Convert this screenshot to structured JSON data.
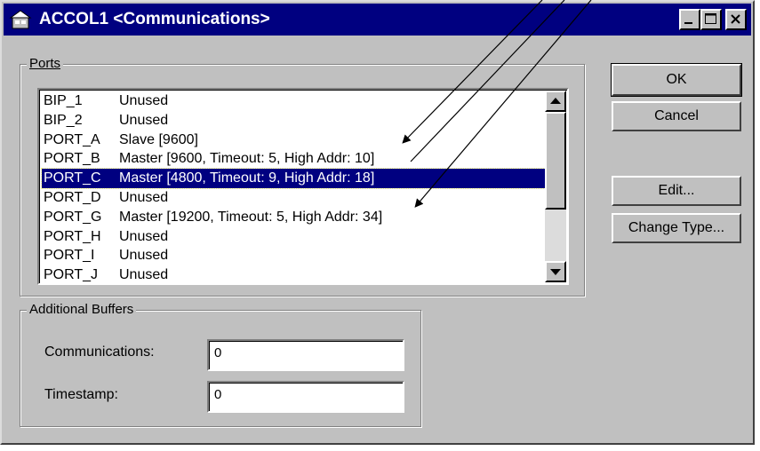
{
  "window": {
    "title": "ACCOL1 <Communications>"
  },
  "ports": {
    "group_label": "Ports",
    "items": [
      {
        "name": "BIP_1",
        "value": "Unused",
        "selected": false
      },
      {
        "name": "BIP_2",
        "value": "Unused",
        "selected": false
      },
      {
        "name": "PORT_A",
        "value": "Slave [9600]",
        "selected": false
      },
      {
        "name": "PORT_B",
        "value": "Master [9600, Timeout: 5, High Addr: 10]",
        "selected": false
      },
      {
        "name": "PORT_C",
        "value": "Master [4800, Timeout: 9, High Addr: 18]",
        "selected": true
      },
      {
        "name": "PORT_D",
        "value": "Unused",
        "selected": false
      },
      {
        "name": "PORT_G",
        "value": "Master [19200, Timeout: 5, High Addr: 34]",
        "selected": false
      },
      {
        "name": "PORT_H",
        "value": "Unused",
        "selected": false
      },
      {
        "name": "PORT_I",
        "value": "Unused",
        "selected": false
      },
      {
        "name": "PORT_J",
        "value": "Unused",
        "selected": false
      }
    ]
  },
  "buttons": {
    "ok": "OK",
    "cancel": "Cancel",
    "edit": "Edit...",
    "change_type": "Change Type..."
  },
  "buffers": {
    "group_label": "Additional Buffers",
    "communications_label": "Communications:",
    "communications_value": "0",
    "timestamp_label": "Timestamp:",
    "timestamp_value": "0"
  },
  "colors": {
    "titlebar": "#000080",
    "selection": "#000080",
    "face": "#c0c0c0"
  },
  "icons": [
    "app-icon",
    "minimize-icon",
    "maximize-icon",
    "close-icon",
    "scroll-up-arrow-icon",
    "scroll-down-arrow-icon"
  ]
}
